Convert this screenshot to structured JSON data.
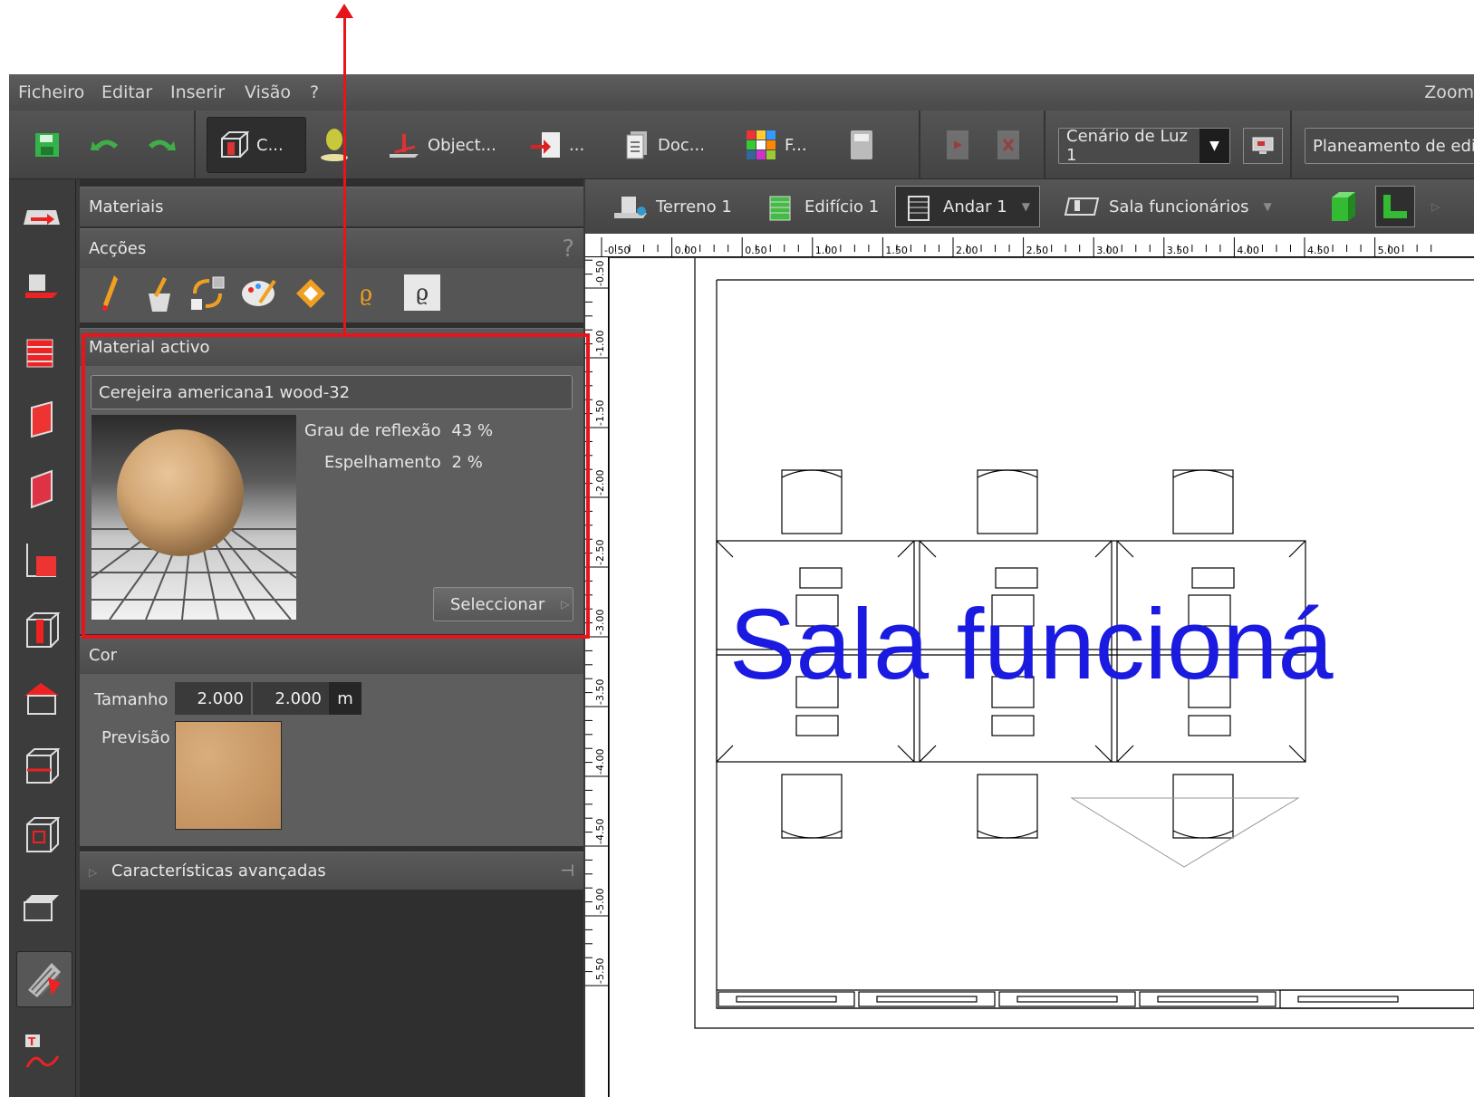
{
  "menu": [
    "Ficheiro",
    "Editar",
    "Inserir",
    "Visão",
    "?"
  ],
  "zoom_label": "Zoom",
  "toolbar": {
    "b1": "C...",
    "b2": "Object...",
    "b3": "...",
    "b4": "Doc...",
    "b5": "F...",
    "light_scene": "Cenário de Luz 1",
    "planning": "Planeamento de edif"
  },
  "tabs": {
    "terrain": "Terreno 1",
    "building": "Edifício 1",
    "floor": "Andar 1",
    "room": "Sala funcionários"
  },
  "panel": {
    "title": "Materiais",
    "actions": "Acções",
    "help": "?",
    "active_material": "Material activo",
    "material_name": "Cerejeira americana1 wood-32",
    "reflection_label": "Grau de reflexão",
    "reflection_value": "43 %",
    "mirror_label": "Espelhamento",
    "mirror_value": "2 %",
    "select": "Seleccionar",
    "color": "Cor",
    "size_label": "Tamanho",
    "size_w": "2.000",
    "size_h": "2.000",
    "unit": "m",
    "preview_label": "Previsão",
    "advanced": "Características avançadas"
  },
  "ruler": {
    "h": [
      "-0.50",
      "0.00",
      "0.50",
      "1.00",
      "1.50",
      "2.00",
      "2.50",
      "3.00",
      "3.50",
      "4.00",
      "4.50",
      "5.00"
    ],
    "v": [
      "-0.50",
      "-1.00",
      "-1.50",
      "-2.00",
      "-2.50",
      "-3.00",
      "-3.50",
      "-4.00",
      "-4.50",
      "-5.00",
      "-5.50"
    ]
  },
  "canvas": {
    "room_label": "Sala funcioná",
    "label_color": "#1a1ae0"
  },
  "colors": {
    "annotation": "#e8141c",
    "wood": "#c89865"
  }
}
